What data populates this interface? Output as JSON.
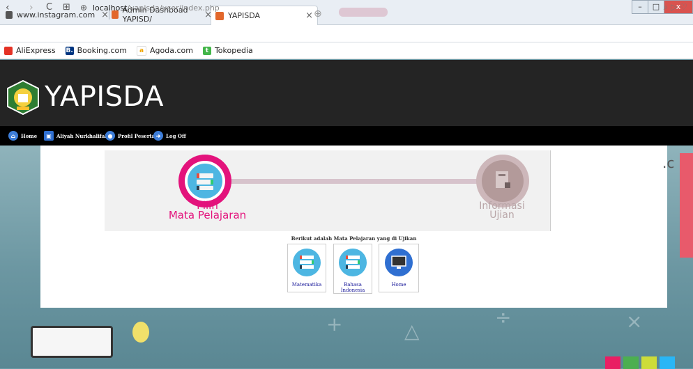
{
  "browser": {
    "tabs": [
      {
        "label": "www.instagram.com",
        "close": "×"
      },
      {
        "label": "Admin Dashboad YAPISD/",
        "close": "×"
      },
      {
        "label": "YAPISDA",
        "close": "×"
      }
    ],
    "new_tab": "⊕",
    "window_controls": {
      "minimize": "–",
      "maximize": "□",
      "close": "x"
    },
    "nav": {
      "back": "‹",
      "forward": "›",
      "reload": "C",
      "apps": "⊞"
    },
    "url": {
      "host": "localhost",
      "path": "/yapisda/user/index.php"
    },
    "url_actions": "⌕ ▷ ♡",
    "bookmarks": [
      {
        "label": "AliExpress",
        "color": "#e43225",
        "icon": "A"
      },
      {
        "label": "Booking.com",
        "color": "#003580",
        "icon": "B."
      },
      {
        "label": "Agoda.com",
        "color": "#f0a500",
        "icon": "a"
      },
      {
        "label": "Tokopedia",
        "color": "#42b549",
        "icon": "t"
      }
    ]
  },
  "site": {
    "brand": "YAPISDA",
    "menu": [
      {
        "label": "Home",
        "icon": "home-icon"
      },
      {
        "label": "Aliyah Nurkhalifah",
        "icon": "user-card-icon"
      },
      {
        "label": "Profil Peserta",
        "icon": "profile-icon"
      },
      {
        "label": "Log Off",
        "icon": "logoff-icon"
      }
    ]
  },
  "stepper": {
    "step1": {
      "line1": "Pilih",
      "line2": "Mata Pelajaran"
    },
    "step2": {
      "line1": "Informasi",
      "line2": "Ujian"
    }
  },
  "subjects_title": "Berikut adalah Mata Pelajaran yang di Ujikan",
  "subjects": [
    {
      "label": "Matematika"
    },
    {
      "label": "Bahasa Indonesia"
    },
    {
      "label": "Home"
    }
  ],
  "colors": {
    "accent_pink": "#e3137c",
    "icon_blue": "#4db6e2",
    "header_dark": "#242424",
    "menu_black": "#000000"
  }
}
